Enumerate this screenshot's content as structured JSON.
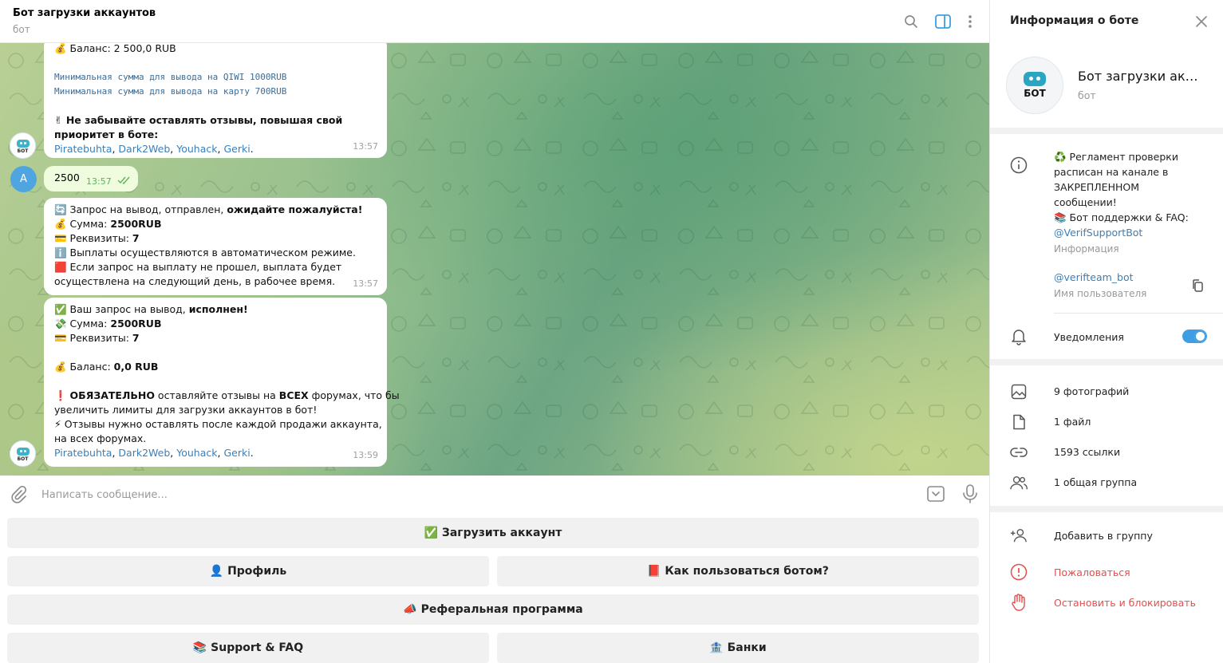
{
  "header": {
    "title": "Бот загрузки аккаунтов",
    "subtitle": "бот"
  },
  "messages": {
    "m1": {
      "balance": "💰 Баланс: 2 500,0 RUB",
      "min_qiwi": "Минимальная сумма для вывода на QIWI 1000RUB",
      "min_card": "Минимальная сумма для вывода на карту 700RUB",
      "reminder_line1": "✌ Не забывайте оставлять отзывы, повышая свой",
      "reminder_line2": "приоритет в боте:",
      "links": [
        "Piratebuhta",
        "Dark2Web",
        "Youhack",
        "Gerki"
      ],
      "time": "13:57"
    },
    "m2": {
      "avatar_letter": "A",
      "text": "2500",
      "time": "13:57"
    },
    "m3": {
      "line1_a": "🔄 Запрос на вывод,  отправлен, ",
      "line1_b": "ожидайте пожалуйста!",
      "line2_a": "💰 Сумма: ",
      "line2_b": "2500RUB",
      "line3_a": "💳 Реквизиты: ",
      "line3_b": "7",
      "line4": "ℹ️ Выплаты осуществляются в автоматическом режиме.",
      "line5": "🟥 Если запрос на выплату не прошел, выплата будет",
      "line6": "осуществлена на следующий день, в рабочее время.",
      "time": "13:57"
    },
    "m4": {
      "line1_a": "✅ Ваш запрос на вывод, ",
      "line1_b": "исполнен!",
      "line2_a": "💸 Сумма: ",
      "line2_b": "2500RUB",
      "line3_a": "💳 Реквизиты: ",
      "line3_b": "7",
      "line4_a": "💰 Баланс: ",
      "line4_b": "0,0 RUB",
      "line5_a": "❗ ",
      "line5_b": "ОБЯЗАТЕЛЬНО",
      "line5_c": " оставляйте отзывы на ",
      "line5_d": "ВСЕХ",
      "line5_e": " форумах, что бы",
      "line6": "увеличить лимиты для загрузки аккаунтов в бот!",
      "line7": "⚡ Отзывы нужно оставлять после каждой продажи аккаунта,",
      "line8": "на всех форумах.",
      "links": [
        "Piratebuhta",
        "Dark2Web",
        "Youhack",
        "Gerki"
      ],
      "time": "13:59"
    },
    "bot_avatar_text": "БОТ"
  },
  "composer": {
    "placeholder": "Написать сообщение..."
  },
  "keyboard": {
    "upload": "✅ Загрузить аккаунт",
    "profile": "👤 Профиль",
    "howto": "📕 Как пользоваться ботом?",
    "referral": "📣 Реферальная программа",
    "support": "📚 Support & FAQ",
    "banks": "🏦 Банки"
  },
  "info_panel": {
    "title": "Информация о боте",
    "name": "Бот загрузки аккаунтов",
    "subtitle": "бот",
    "avatar_text": "БОТ",
    "about_lines": [
      "♻️ Регламент проверки",
      "расписан на канале в",
      "ЗАКРЕПЛЕННОМ",
      "сообщении!",
      "📚 Бот поддержки & FAQ:"
    ],
    "about_link": "@VerifSupportBot",
    "about_label": "Информация",
    "username": "@verifteam_bot",
    "username_label": "Имя пользователя",
    "notifications": "Уведомления",
    "notifications_on": true,
    "media": {
      "photos": "9 фотографий",
      "files": "1 файл",
      "links": "1593 ссылки",
      "groups": "1 общая группа"
    },
    "actions": {
      "add_to_group": "Добавить в группу",
      "report": "Пожаловаться",
      "block": "Остановить и блокировать"
    }
  },
  "colors": {
    "accent": "#3f9ee3",
    "link": "#3a7fb9",
    "danger": "#e0504d",
    "outgoing_bubble": "#effdde"
  }
}
